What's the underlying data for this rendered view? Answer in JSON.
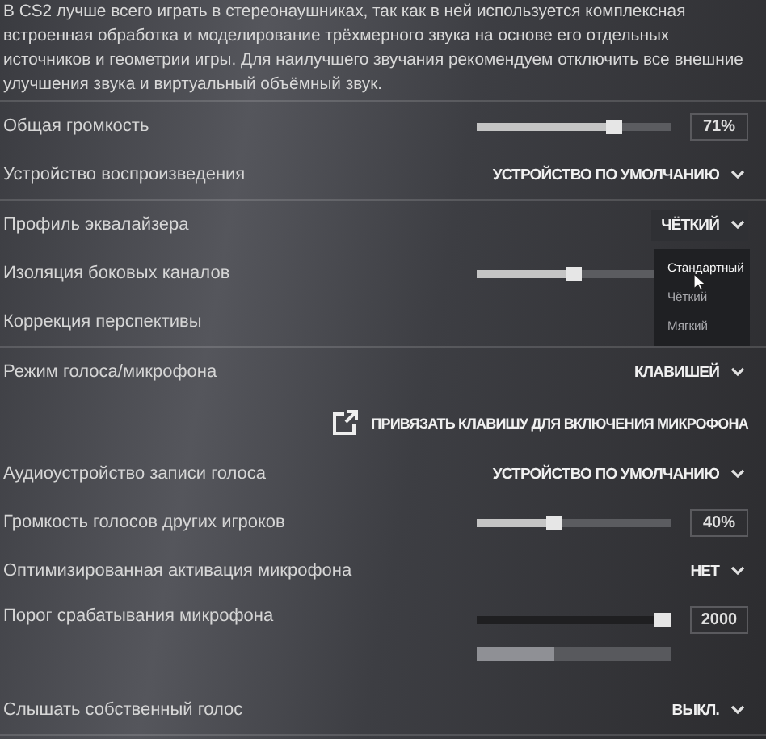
{
  "intro": "В CS2 лучше всего играть в стереонаушниках, так как в ней используется комплексная встроенная обработка и моделирование трёхмерного звука на основе его отдельных источников и геометрии игры. Для наилучшего звучания рекомендуем отключить все внешние улучшения звука и виртуальный объёмный звук.",
  "sections": [
    {
      "rows": [
        {
          "kind": "slider",
          "label": "Общая громкость",
          "level": 0.71,
          "value": "71%"
        },
        {
          "kind": "dropdown",
          "label": "Устройство воспроизведения",
          "value": "УСТРОЙСТВО ПО УМОЛЧАНИЮ"
        }
      ]
    },
    {
      "rows": [
        {
          "kind": "dropdown",
          "label": "Профиль эквалайзера",
          "value": "ЧЁТКИЙ",
          "expanded": true,
          "options": [
            {
              "label": "Стандартный",
              "highlighted": true
            },
            {
              "label": "Чёткий",
              "highlighted": false
            },
            {
              "label": "Мягкий",
              "highlighted": false
            }
          ]
        },
        {
          "kind": "slider",
          "label": "Изоляция боковых каналов",
          "level": 0.5
        },
        {
          "kind": "plain",
          "label": "Коррекция перспективы"
        }
      ]
    },
    {
      "rows": [
        {
          "kind": "dropdown",
          "label": "Режим голоса/микрофона",
          "value": "КЛАВИШЕЙ"
        },
        {
          "kind": "link",
          "label": "ПРИВЯЗАТЬ КЛАВИШУ ДЛЯ ВКЛЮЧЕНИЯ МИКРОФОНА"
        },
        {
          "kind": "dropdown",
          "label": "Аудиоустройство записи голоса",
          "value": "УСТРОЙСТВО ПО УМОЛЧАНИЮ"
        },
        {
          "kind": "slider",
          "label": "Громкость голосов других игроков",
          "level": 0.4,
          "value": "40%"
        },
        {
          "kind": "dropdown",
          "label": "Оптимизированная активация микрофона",
          "value": "НЕТ"
        },
        {
          "kind": "threshold",
          "label": "Порог срабатывания микрофона",
          "level": 1.0,
          "value": "2000",
          "meter": {
            "level": 0.4
          }
        },
        {
          "kind": "dropdown",
          "label": "Слышать собственный голос",
          "value": "ВЫКЛ."
        }
      ]
    }
  ]
}
